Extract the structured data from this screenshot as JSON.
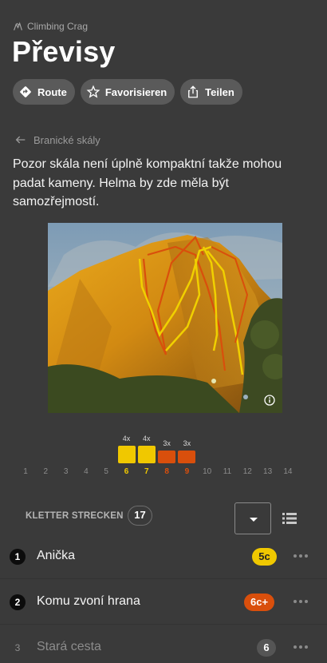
{
  "header": {
    "crag_type": "Climbing Crag",
    "title": "Převisy"
  },
  "actions": [
    {
      "label": "Route",
      "icon": "directions-icon"
    },
    {
      "label": "Favorisieren",
      "icon": "star-outline-icon"
    },
    {
      "label": "Teilen",
      "icon": "share-icon"
    }
  ],
  "breadcrumb": {
    "parent": "Branické skály"
  },
  "description": "Pozor skála není úplně kompaktní takže mohou padat kameny. Helma by zde měla být samozřejmostí.",
  "colors": {
    "background": "#3a3a3a",
    "yellow": "#f0c800",
    "orange": "#d94f0c",
    "chip": "#5a5a5a"
  },
  "chart_data": {
    "type": "bar",
    "categories": [
      "1",
      "2",
      "3",
      "4",
      "5",
      "6",
      "7",
      "8",
      "9",
      "10",
      "11",
      "12",
      "13",
      "14"
    ],
    "values": [
      0,
      0,
      0,
      0,
      0,
      4,
      4,
      3,
      3,
      0,
      0,
      0,
      0,
      0
    ],
    "labels": [
      "",
      "",
      "",
      "",
      "",
      "4x",
      "4x",
      "3x",
      "3x",
      "",
      "",
      "",
      "",
      ""
    ],
    "colors": [
      "",
      "",
      "",
      "",
      "",
      "#f0c800",
      "#f0c800",
      "#d94f0c",
      "#d94f0c",
      "",
      "",
      "",
      "",
      ""
    ]
  },
  "routes_section": {
    "label": "KLETTER STRECKEN",
    "count": "17",
    "dropdown_value": "",
    "view_toggle_icon": "list-icon"
  },
  "routes": [
    {
      "number": "1",
      "name": "Anička",
      "grade": "5c",
      "grade_color": "#f0c800",
      "grade_text_color": "#222222"
    },
    {
      "number": "2",
      "name": "Komu zvoní hrana",
      "grade": "6c+",
      "grade_color": "#d94f0c",
      "grade_text_color": "#ffffff"
    },
    {
      "number": "3",
      "name": "Stará cesta",
      "grade": "6",
      "grade_color": "#555555",
      "grade_text_color": "#ffffff"
    }
  ]
}
